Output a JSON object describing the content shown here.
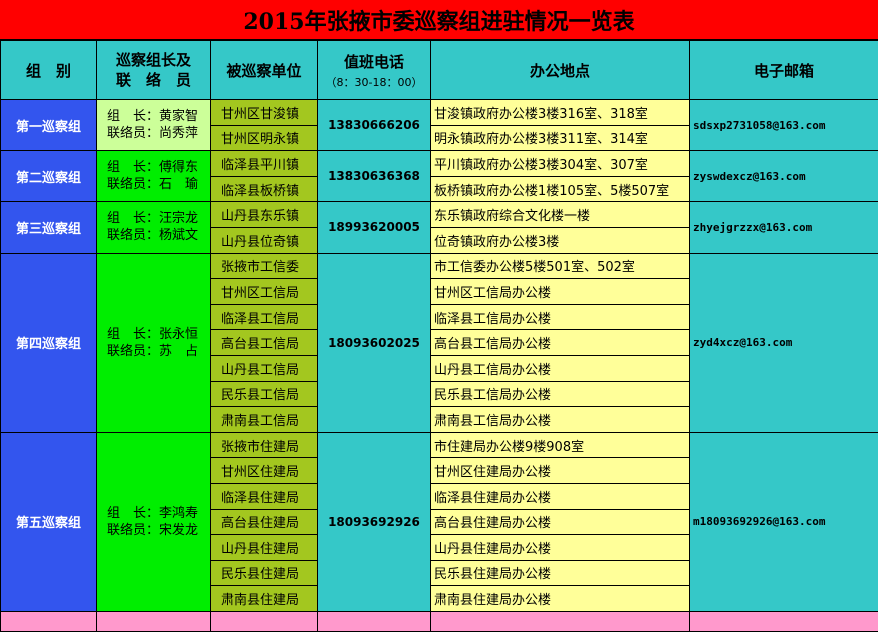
{
  "title": "2015年张掖市委巡察组进驻情况一览表",
  "headers": {
    "group": "组　别",
    "leader_line1": "巡察组长及",
    "leader_line2": "联　络　员",
    "unit": "被巡察单位",
    "phone": "值班电话",
    "phone_hours": "（8：30-18：00）",
    "address": "办公地点",
    "email": "电子邮箱"
  },
  "groups": [
    {
      "name": "第一巡察组",
      "leader": "组　长：黄家智",
      "liaison": "联络员：尚秀萍",
      "phone": "13830666206",
      "email": "sdsxp2731058@163.com",
      "rows": [
        {
          "unit": "甘州区甘浚镇",
          "address": "甘浚镇政府办公楼3楼316室、318室"
        },
        {
          "unit": "甘州区明永镇",
          "address": "明永镇政府办公楼3楼311室、314室"
        }
      ]
    },
    {
      "name": "第二巡察组",
      "leader": "组　长：傅得东",
      "liaison": "联络员：石　瑜",
      "phone": "13830636368",
      "email": "zyswdexcz@163.com",
      "rows": [
        {
          "unit": "临泽县平川镇",
          "address": "平川镇政府办公楼3楼304室、307室"
        },
        {
          "unit": "临泽县板桥镇",
          "address": "板桥镇政府办公楼1楼105室、5楼507室"
        }
      ]
    },
    {
      "name": "第三巡察组",
      "leader": "组　长：汪宗龙",
      "liaison": "联络员：杨斌文",
      "phone": "18993620005",
      "email": "zhyejgrzzx@163.com",
      "rows": [
        {
          "unit": "山丹县东乐镇",
          "address": "东乐镇政府综合文化楼一楼"
        },
        {
          "unit": "山丹县位奇镇",
          "address": "位奇镇政府办公楼3楼"
        }
      ]
    },
    {
      "name": "第四巡察组",
      "leader": "组　长：张永恒",
      "liaison": "联络员：苏　占",
      "phone": "18093602025",
      "email": "zyd4xcz@163.com",
      "rows": [
        {
          "unit": "张掖市工信委",
          "address": "市工信委办公楼5楼501室、502室"
        },
        {
          "unit": "甘州区工信局",
          "address": "甘州区工信局办公楼"
        },
        {
          "unit": "临泽县工信局",
          "address": "临泽县工信局办公楼"
        },
        {
          "unit": "高台县工信局",
          "address": "高台县工信局办公楼"
        },
        {
          "unit": "山丹县工信局",
          "address": "山丹县工信局办公楼"
        },
        {
          "unit": "民乐县工信局",
          "address": "民乐县工信局办公楼"
        },
        {
          "unit": "肃南县工信局",
          "address": "肃南县工信局办公楼"
        }
      ]
    },
    {
      "name": "第五巡察组",
      "leader": "组　长：李鸿寿",
      "liaison": "联络员：宋发龙",
      "phone": "18093692926",
      "email": "m18093692926@163.com",
      "rows": [
        {
          "unit": "张掖市住建局",
          "address": "市住建局办公楼9楼908室"
        },
        {
          "unit": "甘州区住建局",
          "address": "甘州区住建局办公楼"
        },
        {
          "unit": "临泽县住建局",
          "address": "临泽县住建局办公楼"
        },
        {
          "unit": "高台县住建局",
          "address": "高台县住建局办公楼"
        },
        {
          "unit": "山丹县住建局",
          "address": "山丹县住建局办公楼"
        },
        {
          "unit": "民乐县住建局",
          "address": "民乐县住建局办公楼"
        },
        {
          "unit": "肃南县住建局",
          "address": "肃南县住建局办公楼"
        }
      ]
    }
  ]
}
